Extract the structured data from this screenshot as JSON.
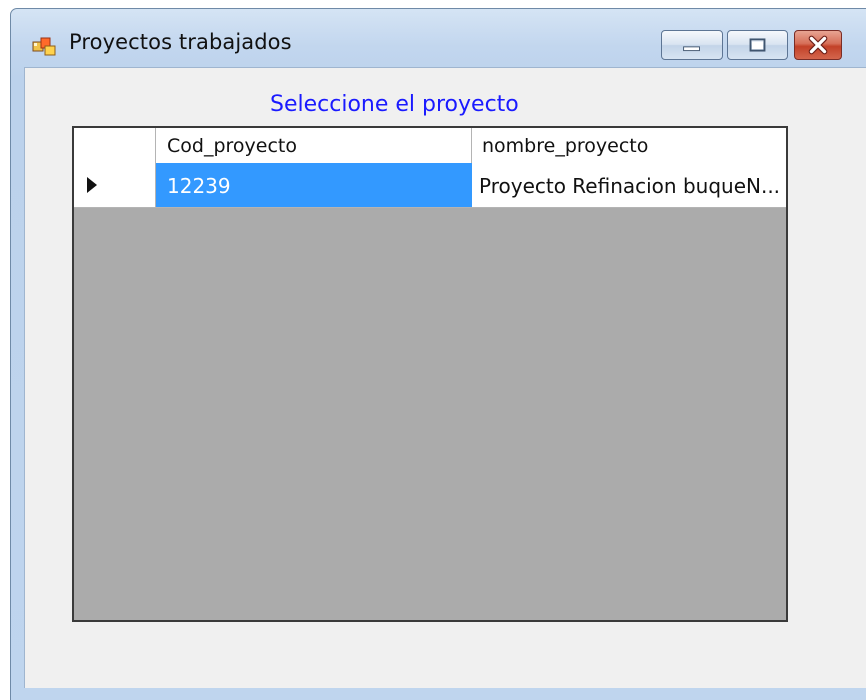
{
  "window": {
    "title": "Proyectos trabajados"
  },
  "form": {
    "prompt": "Seleccione el proyecto"
  },
  "grid": {
    "columns": [
      "Cod_proyecto",
      "nombre_proyecto"
    ],
    "rows": [
      {
        "cod_proyecto": "12239",
        "nombre_proyecto": "Proyecto Refinacion buqueN..."
      }
    ]
  },
  "colors": {
    "selection": "#3399ff",
    "grid_background": "#ababab",
    "prompt_text": "#1a1aff"
  }
}
